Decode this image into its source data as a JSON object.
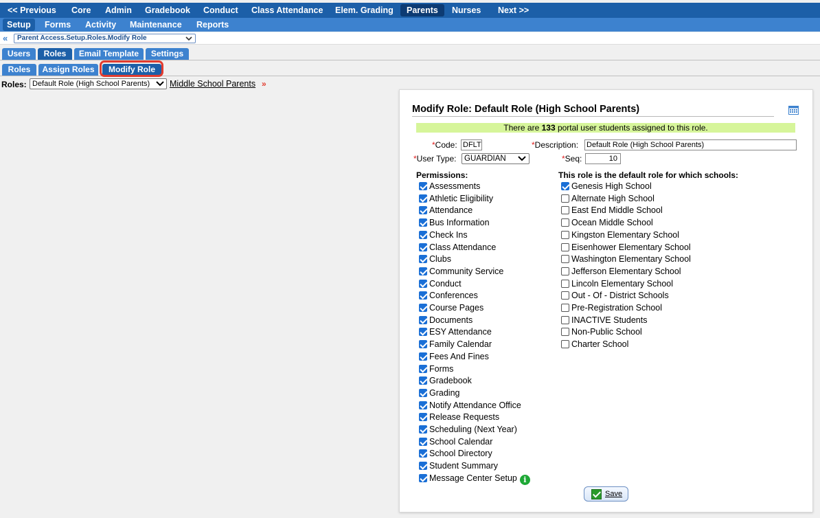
{
  "top_nav": [
    "<< Previous",
    "Core",
    "Admin",
    "Gradebook",
    "Conduct",
    "Class Attendance",
    "Elem. Grading",
    "Parents",
    "Nurses",
    "Next >>"
  ],
  "top_nav_active": "Parents",
  "sub_nav": [
    "Setup",
    "Forms",
    "Activity",
    "Maintenance",
    "Reports"
  ],
  "sub_nav_active": "Setup",
  "breadcrumb": {
    "value": "Parent Access.Setup.Roles.Modify Role"
  },
  "tabs_level1": [
    "Users",
    "Roles",
    "Email Template",
    "Settings"
  ],
  "tabs_level2": [
    "Roles",
    "Assign Roles",
    "Modify Role"
  ],
  "roles_row": {
    "label": "Roles:",
    "selected": "Default Role (High School Parents)",
    "link": "Middle School Parents",
    "more": "»"
  },
  "panel": {
    "title": "Modify Role: Default Role (High School Parents)",
    "banner_pre": "There are ",
    "banner_count": "133",
    "banner_post": " portal user students assigned to this role.",
    "code_label": "Code:",
    "code_value": "DFLT",
    "desc_label": "Description:",
    "desc_value": "Default Role (High School Parents)",
    "usertype_label": "User Type:",
    "usertype_value": "GUARDIAN",
    "seq_label": "Seq:",
    "seq_value": "10",
    "required_mark": "*",
    "permissions_header": "Permissions:",
    "permissions": [
      {
        "label": "Assessments",
        "checked": true
      },
      {
        "label": "Athletic Eligibility",
        "checked": true
      },
      {
        "label": "Attendance",
        "checked": true
      },
      {
        "label": "Bus Information",
        "checked": true
      },
      {
        "label": "Check Ins",
        "checked": true
      },
      {
        "label": "Class Attendance",
        "checked": true
      },
      {
        "label": "Clubs",
        "checked": true
      },
      {
        "label": "Community Service",
        "checked": true
      },
      {
        "label": "Conduct",
        "checked": true
      },
      {
        "label": "Conferences",
        "checked": true
      },
      {
        "label": "Course Pages",
        "checked": true
      },
      {
        "label": "Documents",
        "checked": true
      },
      {
        "label": "ESY Attendance",
        "checked": true
      },
      {
        "label": "Family Calendar",
        "checked": true
      },
      {
        "label": "Fees And Fines",
        "checked": true
      },
      {
        "label": "Forms",
        "checked": true
      },
      {
        "label": "Gradebook",
        "checked": true
      },
      {
        "label": "Grading",
        "checked": true
      },
      {
        "label": "Notify Attendance Office",
        "checked": true
      },
      {
        "label": "Release Requests",
        "checked": true
      },
      {
        "label": "Scheduling (Next Year)",
        "checked": true
      },
      {
        "label": "School Calendar",
        "checked": true
      },
      {
        "label": "School Directory",
        "checked": true
      },
      {
        "label": "Student Summary",
        "checked": true
      },
      {
        "label": "Message Center Setup",
        "checked": true,
        "info": "i"
      }
    ],
    "schools_header": "This role is the default role for which schools:",
    "schools": [
      {
        "label": "Genesis High School",
        "checked": true
      },
      {
        "label": "Alternate High School",
        "checked": false
      },
      {
        "label": "East End Middle School",
        "checked": false
      },
      {
        "label": "Ocean Middle School",
        "checked": false
      },
      {
        "label": "Kingston Elementary School",
        "checked": false
      },
      {
        "label": "Eisenhower Elementary School",
        "checked": false
      },
      {
        "label": "Washington Elementary School",
        "checked": false
      },
      {
        "label": "Jefferson Elementary School",
        "checked": false
      },
      {
        "label": "Lincoln Elementary School",
        "checked": false
      },
      {
        "label": "Out - Of - District Schools",
        "checked": false
      },
      {
        "label": "Pre-Registration School",
        "checked": false
      },
      {
        "label": "INACTIVE Students",
        "checked": false
      },
      {
        "label": "Non-Public School",
        "checked": false
      },
      {
        "label": "Charter School",
        "checked": false
      }
    ],
    "save_label": "Save"
  },
  "icons": {
    "calendar": "calendar-icon",
    "info": "info-icon",
    "save": "checkmark-icon",
    "chevron": "chevron-down-icon",
    "back": "double-chevron-left-icon"
  },
  "colors": {
    "nav": "#1c5fa8",
    "subnav": "#3d82cf",
    "highlight": "#e23c2f",
    "banner": "#d6f59a",
    "checkbox": "#1a6fd6"
  }
}
